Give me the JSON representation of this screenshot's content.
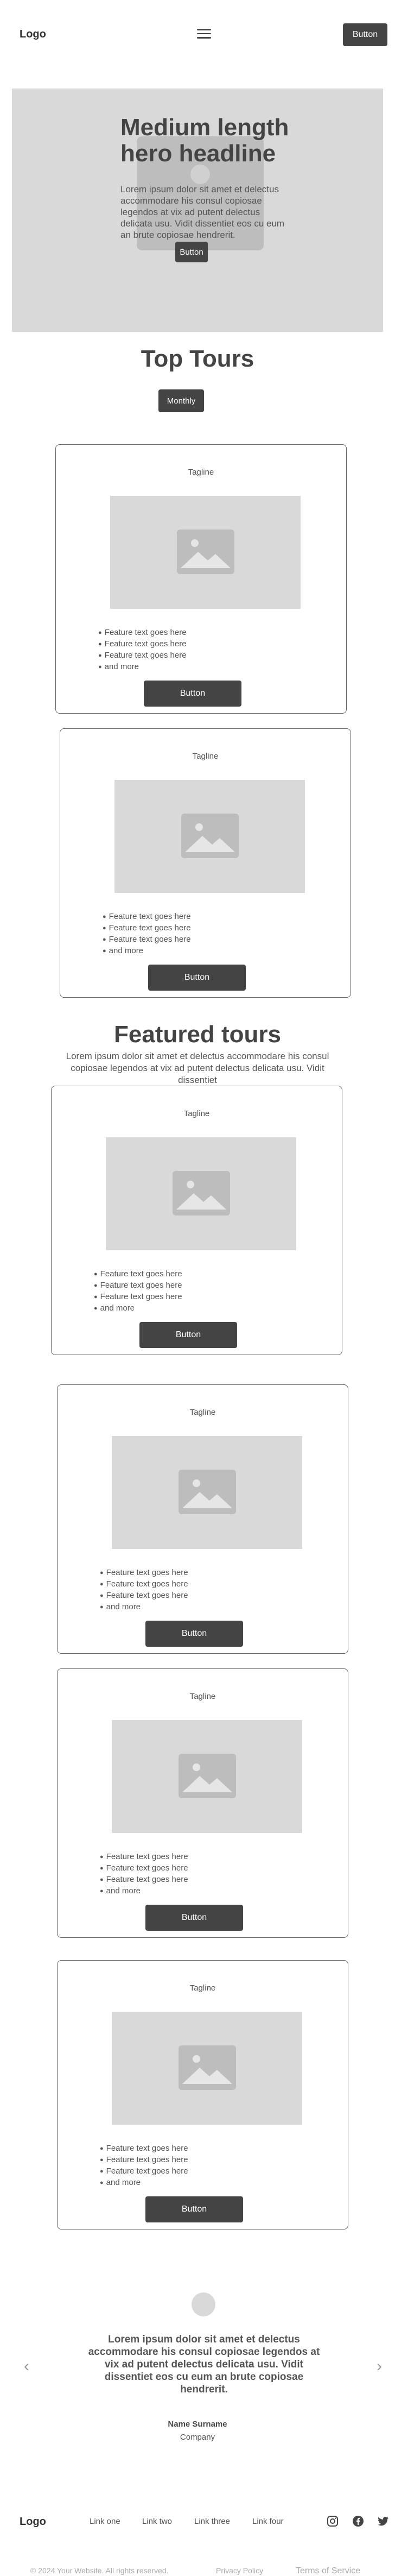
{
  "nav": {
    "logo": "Logo",
    "button_label": "Button"
  },
  "hero": {
    "headline": "Medium length hero headline",
    "text": "Lorem ipsum dolor sit amet et delectus accommodare his consul copiosae legendos at vix ad putent delectus delicata usu. Vidit dissentiet eos cu eum an brute copiosae hendrerit.",
    "button_label": "Button"
  },
  "top_tours": {
    "title": "Top Tours",
    "toggle_label": "Monthly"
  },
  "featured_tours": {
    "title": "Featured tours",
    "text": "Lorem ipsum dolor sit amet et delectus accommodare his consul copiosae legendos at vix ad putent delectus delicata usu. Vidit dissentiet"
  },
  "cards": [
    {
      "tagline": "Tagline",
      "features": [
        "Feature text goes here",
        "Feature text goes here",
        "Feature text goes here",
        "and more"
      ],
      "button_label": "Button"
    },
    {
      "tagline": "Tagline",
      "features": [
        "Feature text goes here",
        "Feature text goes here",
        "Feature text goes here",
        "and more"
      ],
      "button_label": "Button"
    },
    {
      "tagline": "Tagline",
      "features": [
        "Feature text goes here",
        "Feature text goes here",
        "Feature text goes here",
        "and more"
      ],
      "button_label": "Button"
    },
    {
      "tagline": "Tagline",
      "features": [
        "Feature text goes here",
        "Feature text goes here",
        "Feature text goes here",
        "and more"
      ],
      "button_label": "Button"
    },
    {
      "tagline": "Tagline",
      "features": [
        "Feature text goes here",
        "Feature text goes here",
        "Feature text goes here",
        "and more"
      ],
      "button_label": "Button"
    },
    {
      "tagline": "Tagline",
      "features": [
        "Feature text goes here",
        "Feature text goes here",
        "Feature text goes here",
        "and more"
      ],
      "button_label": "Button"
    }
  ],
  "testimonial": {
    "quote": "Lorem ipsum dolor sit amet et delectus accommodare his consul copiosae legendos at vix ad putent delectus delicata usu. Vidit dissentiet eos cu eum an brute copiosae hendrerit.",
    "name": "Name Surname",
    "company": "Company",
    "prev_icon": "chevron-left-icon",
    "next_icon": "chevron-right-icon"
  },
  "footer": {
    "logo": "Logo",
    "links": [
      "Link one",
      "Link two",
      "Link three",
      "Link four"
    ],
    "social_icons": [
      "instagram-icon",
      "facebook-icon",
      "twitter-icon"
    ],
    "copyright": "© 2024 Your Website. All rights reserved.",
    "privacy": "Privacy Policy",
    "terms": "Terms of Service"
  },
  "colors": {
    "dark": "#444444",
    "placeholder_gray": "#d9d9d9",
    "border": "#666666"
  }
}
